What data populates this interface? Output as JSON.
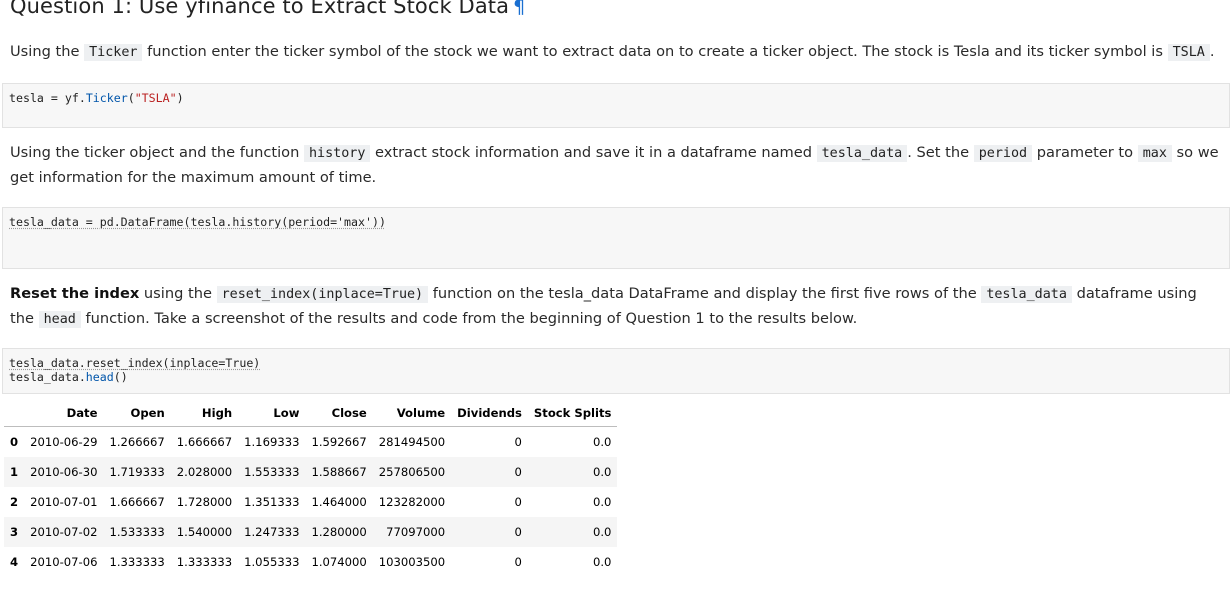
{
  "heading": {
    "title": "Question 1: Use yfinance to Extract Stock Data",
    "pilcrow": "¶"
  },
  "para1": {
    "t1": "Using the ",
    "c1": "Ticker",
    "t2": " function enter the ticker symbol of the stock we want to extract data on to create a ticker object. The stock is Tesla and its ticker symbol is ",
    "c2": "TSLA",
    "t3": "."
  },
  "code1": {
    "var": "tesla",
    "op": " = ",
    "obj": "yf",
    "dot": ".",
    "fn": "Ticker",
    "open": "(",
    "str": "\"TSLA\"",
    "close": ")"
  },
  "para2": {
    "t1": "Using the ticker object and the function ",
    "c1": "history",
    "t2": " extract stock information and save it in a dataframe named ",
    "c2": "tesla_data",
    "t3": ". Set the ",
    "c3": "period",
    "t4": " parameter to ",
    "c4": "max",
    "t5": " so we get information for the maximum amount of time."
  },
  "code2": {
    "line": "tesla_data = pd.DataFrame(tesla.history(period='max'))"
  },
  "para3": {
    "b1": "Reset the index",
    "t1": " using the ",
    "c1": "reset_index(inplace=True)",
    "t2": " function on the tesla_data DataFrame and display the first five rows of the ",
    "c2": "tesla_data",
    "t3": " dataframe using the ",
    "c3": "head",
    "t4": " function. Take a screenshot of the results and code from the beginning of Question 1 to the results below."
  },
  "code3": {
    "line1": "tesla_data.reset_index(inplace=True)",
    "line2_obj": "tesla_data",
    "line2_dot": ".",
    "line2_fn": "head",
    "line2_paren": "()"
  },
  "table": {
    "columns": [
      "",
      "Date",
      "Open",
      "High",
      "Low",
      "Close",
      "Volume",
      "Dividends",
      "Stock Splits"
    ],
    "rows": [
      [
        "0",
        "2010-06-29",
        "1.266667",
        "1.666667",
        "1.169333",
        "1.592667",
        "281494500",
        "0",
        "0.0"
      ],
      [
        "1",
        "2010-06-30",
        "1.719333",
        "2.028000",
        "1.553333",
        "1.588667",
        "257806500",
        "0",
        "0.0"
      ],
      [
        "2",
        "2010-07-01",
        "1.666667",
        "1.728000",
        "1.351333",
        "1.464000",
        "123282000",
        "0",
        "0.0"
      ],
      [
        "3",
        "2010-07-02",
        "1.533333",
        "1.540000",
        "1.247333",
        "1.280000",
        "77097000",
        "0",
        "0.0"
      ],
      [
        "4",
        "2010-07-06",
        "1.333333",
        "1.333333",
        "1.055333",
        "1.074000",
        "103003500",
        "0",
        "0.0"
      ]
    ]
  }
}
